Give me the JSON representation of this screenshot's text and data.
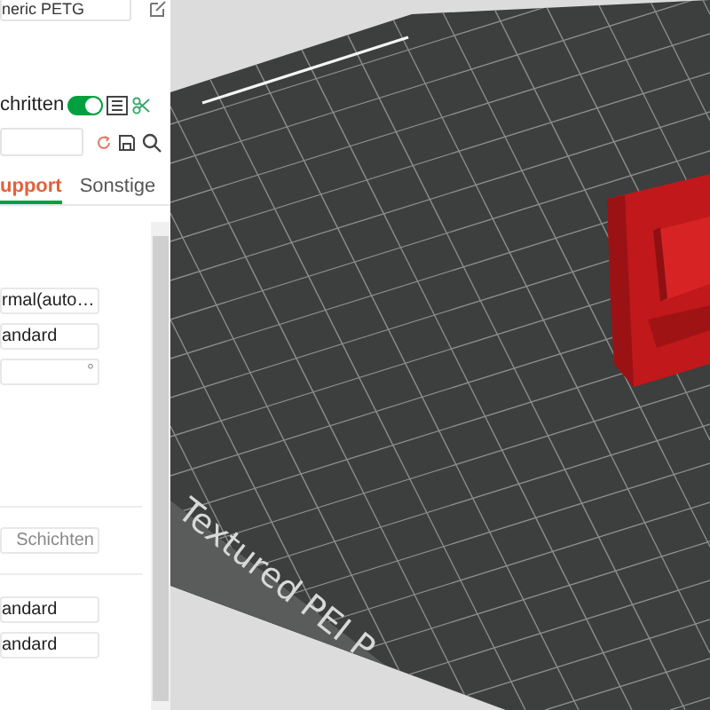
{
  "filament": {
    "value": "neric PETG"
  },
  "toolbar": {
    "label": "chritten",
    "toggle_on": true
  },
  "tabs": [
    {
      "label": "upport",
      "selected": true
    },
    {
      "label": "Sonstige",
      "selected": false
    }
  ],
  "groups": [
    [
      {
        "kind": "value",
        "value": "rmal(auto…"
      },
      {
        "kind": "value",
        "value": "andard"
      },
      {
        "kind": "suffix",
        "suffix": "°"
      }
    ],
    [
      {
        "kind": "suffix",
        "suffix": "Schichten"
      }
    ],
    [
      {
        "kind": "value",
        "value": "andard"
      },
      {
        "kind": "value",
        "value": "andard"
      }
    ]
  ],
  "plate": {
    "label": "Textured PEI P"
  }
}
